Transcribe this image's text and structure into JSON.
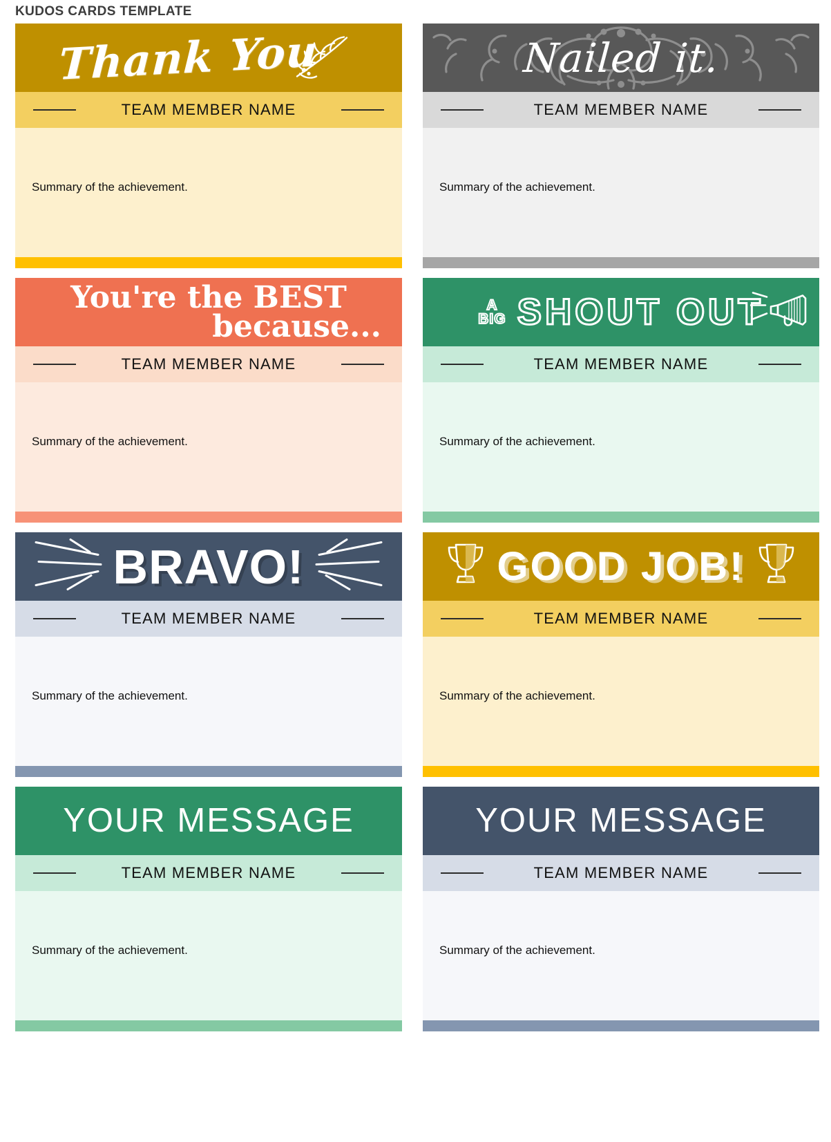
{
  "page": {
    "title": "KUDOS CARDS TEMPLATE"
  },
  "labels": {
    "member_name": "TEAM MEMBER NAME",
    "summary": "Summary of the achievement."
  },
  "colors": {
    "gold_header": "#BF9000",
    "gold_band": "#F3CF60",
    "gold_body": "#FDF0CD",
    "gold_bar": "#FFC000",
    "gray_header": "#585858",
    "gray_band": "#D9D9D9",
    "gray_body": "#F1F1F1",
    "gray_bar": "#A6A6A6",
    "salmon_header": "#EF7151",
    "salmon_band": "#FBDCC9",
    "salmon_body": "#FDEADE",
    "salmon_bar": "#F79277",
    "green_header": "#2E9267",
    "green_band": "#C6EAD8",
    "green_body": "#E9F8F0",
    "green_bar": "#84C9A3",
    "navy_header": "#44546A",
    "navy_band": "#D6DCE7",
    "navy_body": "#F6F7FA",
    "navy_bar": "#8496B0",
    "title_text": "#3D3D3D"
  },
  "cards": [
    {
      "id": "thank-you",
      "headline": "Thank You",
      "headline_lines": [
        "Thank You"
      ],
      "member_name": "TEAM MEMBER NAME",
      "summary": "Summary of the achievement.",
      "icon": "olive-branch-icon",
      "header_color": "#BF9000",
      "band_color": "#F3CF60",
      "body_color": "#FDF0CD",
      "bar_color": "#FFC000"
    },
    {
      "id": "nailed-it",
      "headline": "Nailed it.",
      "headline_lines": [
        "Nailed it."
      ],
      "member_name": "TEAM MEMBER NAME",
      "summary": "Summary of the achievement.",
      "icon": "damask-ornament-icon",
      "header_color": "#585858",
      "band_color": "#D9D9D9",
      "body_color": "#F1F1F1",
      "bar_color": "#A6A6A6"
    },
    {
      "id": "youre-the-best",
      "headline": "You're the BEST because...",
      "headline_lines": [
        "You're the BEST",
        "because..."
      ],
      "member_name": "TEAM MEMBER NAME",
      "summary": "Summary of the achievement.",
      "icon": "none",
      "header_color": "#EF7151",
      "band_color": "#FBDCC9",
      "body_color": "#FDEADE",
      "bar_color": "#F79277"
    },
    {
      "id": "shout-out",
      "headline": "A BIG SHOUT OUT",
      "headline_lines": [
        "A",
        "BIG",
        "SHOUT OUT"
      ],
      "member_name": "TEAM MEMBER NAME",
      "summary": "Summary of the achievement.",
      "icon": "megaphone-icon",
      "header_color": "#2E9267",
      "band_color": "#C6EAD8",
      "body_color": "#E9F8F0",
      "bar_color": "#84C9A3"
    },
    {
      "id": "bravo",
      "headline": "BRAVO!",
      "headline_lines": [
        "BRAVO!"
      ],
      "member_name": "TEAM MEMBER NAME",
      "summary": "Summary of the achievement.",
      "icon": "burst-rays-icon",
      "header_color": "#44546A",
      "band_color": "#D6DCE7",
      "body_color": "#F6F7FA",
      "bar_color": "#8496B0"
    },
    {
      "id": "good-job",
      "headline": "GOOD JOB!",
      "headline_lines": [
        "GOOD JOB!"
      ],
      "member_name": "TEAM MEMBER NAME",
      "summary": "Summary of the achievement.",
      "icon": "trophy-icon",
      "header_color": "#BF9000",
      "band_color": "#F3CF60",
      "body_color": "#FDF0CD",
      "bar_color": "#FFC000"
    },
    {
      "id": "your-message-green",
      "headline": "YOUR MESSAGE",
      "headline_lines": [
        "YOUR MESSAGE"
      ],
      "member_name": "TEAM MEMBER NAME",
      "summary": "Summary of the achievement.",
      "icon": "none",
      "header_color": "#2E9267",
      "band_color": "#C6EAD8",
      "body_color": "#E9F8F0",
      "bar_color": "#84C9A3"
    },
    {
      "id": "your-message-navy",
      "headline": "YOUR MESSAGE",
      "headline_lines": [
        "YOUR MESSAGE"
      ],
      "member_name": "TEAM MEMBER NAME",
      "summary": "Summary of the achievement.",
      "icon": "none",
      "header_color": "#44546A",
      "band_color": "#D6DCE7",
      "body_color": "#F6F7FA",
      "bar_color": "#8496B0"
    }
  ]
}
